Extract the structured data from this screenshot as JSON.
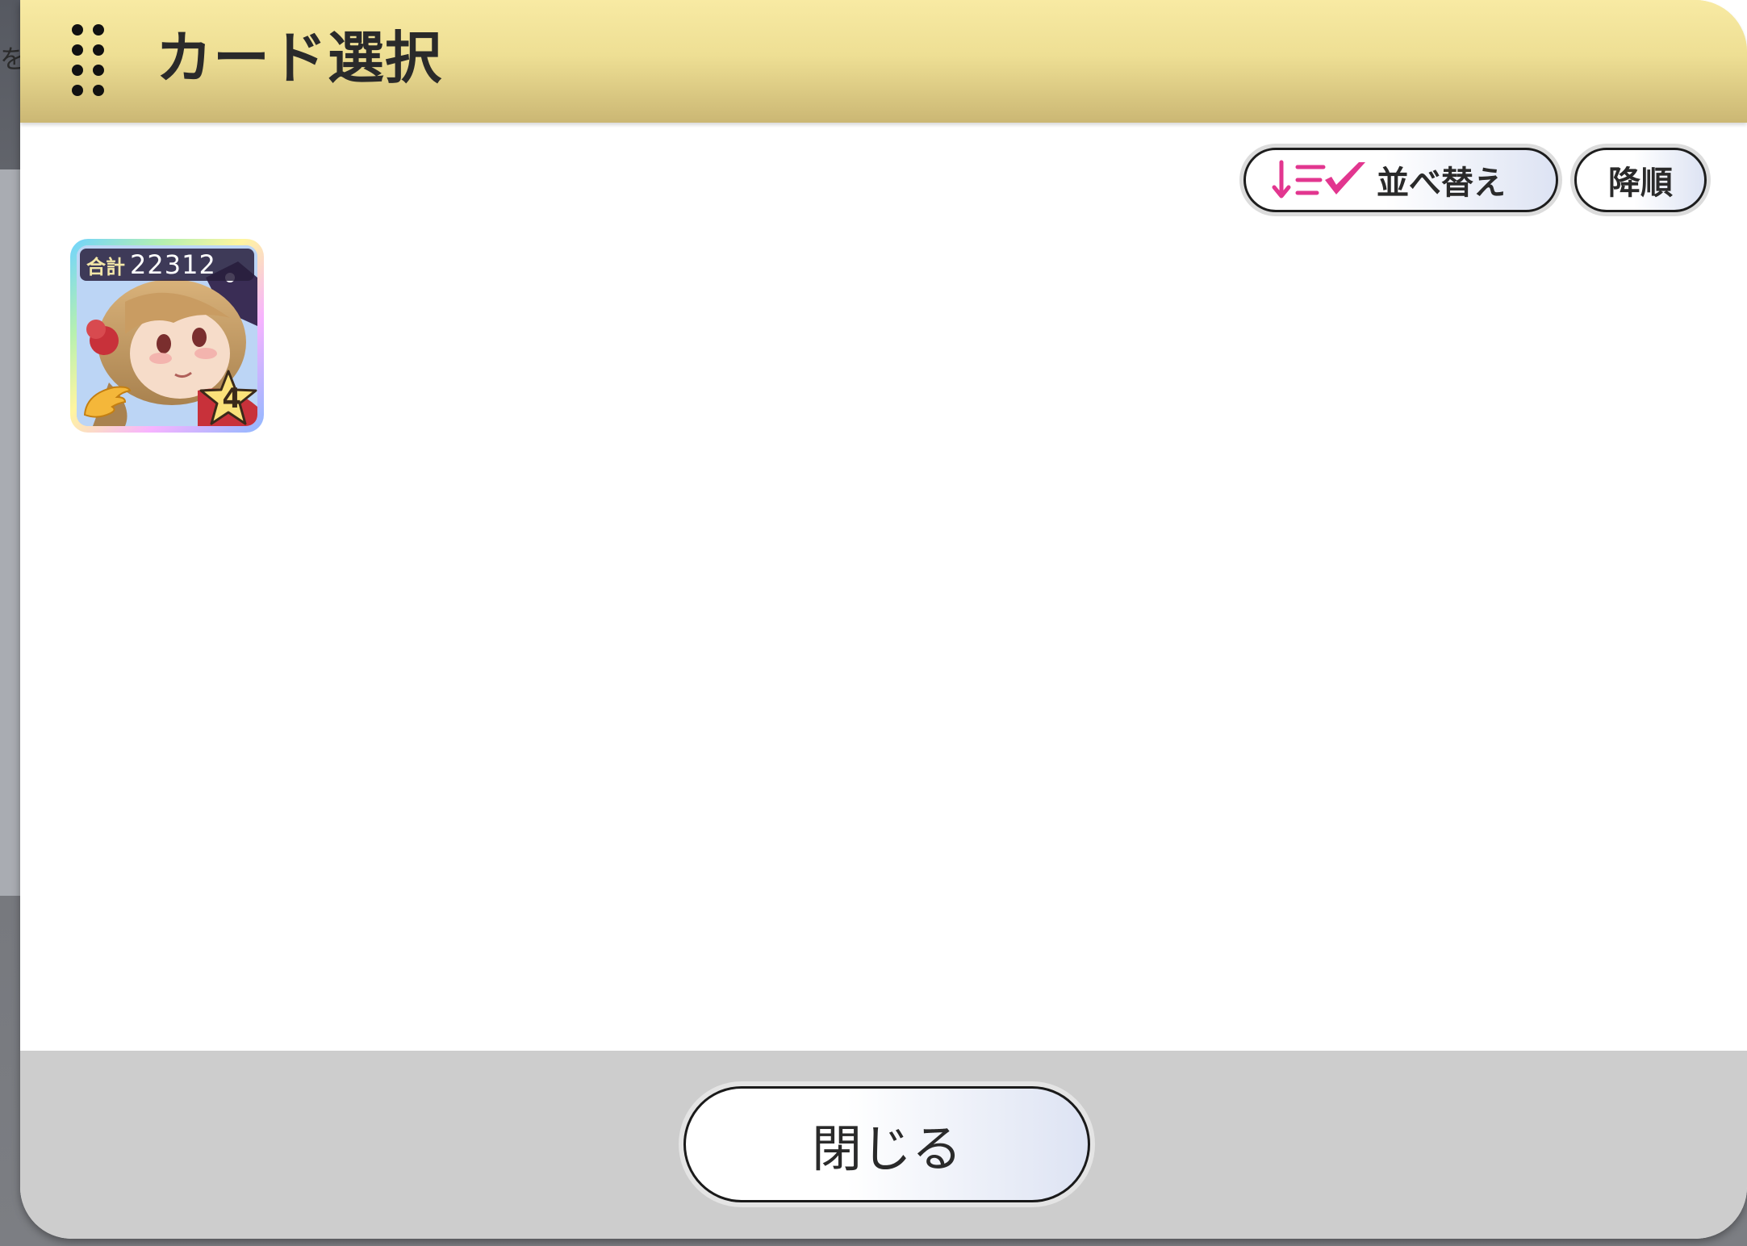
{
  "background": {
    "edge_text": "を"
  },
  "dialog": {
    "title": "カード選択",
    "colors": {
      "header_top": "#f8eaa3",
      "header_bottom": "#cbb774",
      "footer": "#cdcdcd",
      "accent_pink": "#e2368f"
    }
  },
  "toolbar": {
    "sort_label": "並べ替え",
    "sort_icon": "sort-list-check-icon",
    "order_label": "降順"
  },
  "cards": [
    {
      "total_label": "合計",
      "total_value": "22312",
      "badge_icon": "wing-icon",
      "star_rank": "4"
    }
  ],
  "footer": {
    "close_label": "閉じる"
  }
}
